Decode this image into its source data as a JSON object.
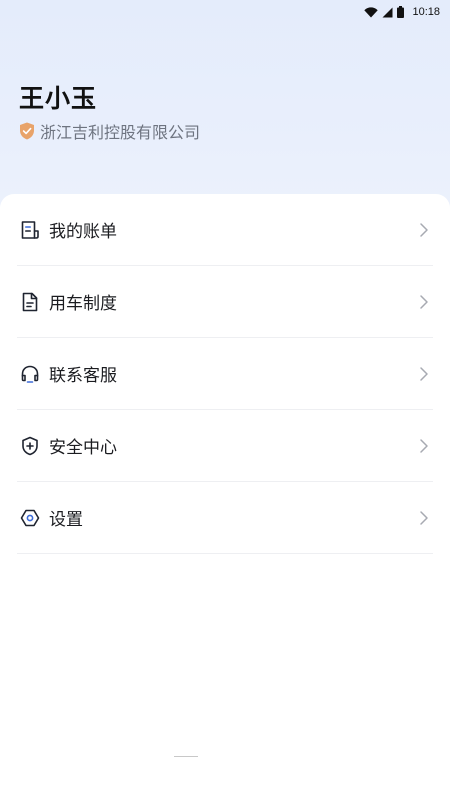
{
  "status_bar": {
    "time": "10:18",
    "icons": [
      "wifi-icon",
      "cellular-signal-icon",
      "battery-icon"
    ]
  },
  "profile": {
    "name": "王小玉",
    "company": "浙江吉利控股有限公司",
    "verified_icon": "shield-check-icon",
    "verified_color": "#e8a36a"
  },
  "menu": {
    "items": [
      {
        "label": "我的账单",
        "icon": "bill-icon"
      },
      {
        "label": "用车制度",
        "icon": "document-icon"
      },
      {
        "label": "联系客服",
        "icon": "headset-icon"
      },
      {
        "label": "安全中心",
        "icon": "shield-plus-icon"
      },
      {
        "label": "设置",
        "icon": "settings-icon"
      }
    ],
    "chevron_icon": "chevron-right-icon"
  },
  "colors": {
    "accent": "#3d6cd8",
    "icon_stroke": "#1f2430",
    "header_bg": "#e6edfb"
  }
}
